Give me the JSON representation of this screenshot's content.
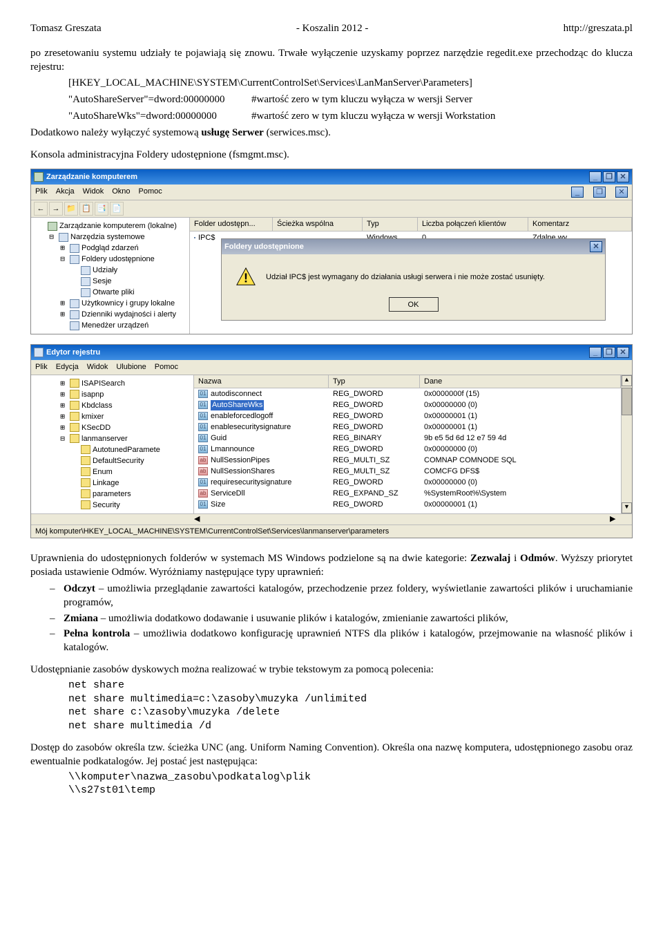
{
  "header": {
    "left": "Tomasz Greszata",
    "center": "- Koszalin 2012 -",
    "right": "http://greszata.pl"
  },
  "p1": "po zresetowaniu systemu udziały te pojawiają się znowu. Trwałe wyłączenie uzyskamy poprzez narzędzie regedit.exe przechodząc do klucza rejestru:",
  "reg_path": "[HKEY_LOCAL_MACHINE\\SYSTEM\\CurrentControlSet\\Services\\LanManServer\\Parameters]",
  "kv1k": "\"AutoShareServer\"=dword:00000000",
  "kv1v": "#wartość zero w tym kluczu wyłącza w wersji Server",
  "kv2k": "\"AutoShareWks\"=dword:00000000",
  "kv2v": "#wartość zero w tym kluczu wyłącza w wersji Workstation",
  "p2a": "Dodatkowo należy wyłączyć systemową ",
  "p2b": "usługę Serwer",
  "p2c": " (serwices.msc).",
  "p3": "Konsola administracyjna Foldery udostępnione (fsmgmt.msc).",
  "win1": {
    "title": "Zarządzanie komputerem",
    "menu": [
      "Plik",
      "Akcja",
      "Widok",
      "Okno",
      "Pomoc"
    ],
    "tree": [
      {
        "ind": 0,
        "exp": "",
        "ico": "g",
        "txt": "Zarządzanie komputerem (lokalne)"
      },
      {
        "ind": 1,
        "exp": "⊟",
        "ico": "b",
        "txt": "Narzędzia systemowe"
      },
      {
        "ind": 2,
        "exp": "⊞",
        "ico": "b",
        "txt": "Podgląd zdarzeń"
      },
      {
        "ind": 2,
        "exp": "⊟",
        "ico": "b",
        "txt": "Foldery udostępnione"
      },
      {
        "ind": 3,
        "exp": "",
        "ico": "b",
        "txt": "Udziały"
      },
      {
        "ind": 3,
        "exp": "",
        "ico": "b",
        "txt": "Sesje"
      },
      {
        "ind": 3,
        "exp": "",
        "ico": "b",
        "txt": "Otwarte pliki"
      },
      {
        "ind": 2,
        "exp": "⊞",
        "ico": "b",
        "txt": "Użytkownicy i grupy lokalne"
      },
      {
        "ind": 2,
        "exp": "⊞",
        "ico": "b",
        "txt": "Dzienniki wydajności i alerty"
      },
      {
        "ind": 2,
        "exp": "",
        "ico": "b",
        "txt": "Menedżer urządzeń"
      }
    ],
    "cols": [
      "Folder udostępn...",
      "Ścieżka wspólna",
      "Typ",
      "Liczba połączeń klientów",
      "Komentarz"
    ],
    "row": [
      "IPC$",
      "",
      "Windows",
      "0",
      "Zdalne wy"
    ],
    "dlg_title": "Foldery udostępnione",
    "dlg_msg": "Udział IPC$ jest wymagany do działania usługi serwera i nie może zostać usunięty.",
    "dlg_ok": "OK"
  },
  "win2": {
    "title": "Edytor rejestru",
    "menu": [
      "Plik",
      "Edycja",
      "Widok",
      "Ulubione",
      "Pomoc"
    ],
    "tree": [
      {
        "ind": 2,
        "exp": "⊞",
        "ico": "f",
        "txt": "ISAPISearch"
      },
      {
        "ind": 2,
        "exp": "⊞",
        "ico": "f",
        "txt": "isapnp"
      },
      {
        "ind": 2,
        "exp": "⊞",
        "ico": "f",
        "txt": "Kbdclass"
      },
      {
        "ind": 2,
        "exp": "⊞",
        "ico": "f",
        "txt": "kmixer"
      },
      {
        "ind": 2,
        "exp": "⊞",
        "ico": "f",
        "txt": "KSecDD"
      },
      {
        "ind": 2,
        "exp": "⊟",
        "ico": "f",
        "txt": "lanmanserver"
      },
      {
        "ind": 3,
        "exp": "",
        "ico": "f",
        "txt": "AutotunedParamete"
      },
      {
        "ind": 3,
        "exp": "",
        "ico": "f",
        "txt": "DefaultSecurity"
      },
      {
        "ind": 3,
        "exp": "",
        "ico": "f",
        "txt": "Enum"
      },
      {
        "ind": 3,
        "exp": "",
        "ico": "f",
        "txt": "Linkage"
      },
      {
        "ind": 3,
        "exp": "",
        "ico": "f",
        "txt": "parameters"
      },
      {
        "ind": 3,
        "exp": "",
        "ico": "f",
        "txt": "Security"
      }
    ],
    "cols": [
      "Nazwa",
      "Typ",
      "Dane"
    ],
    "rows": [
      {
        "ic": "bin",
        "n": "autodisconnect",
        "t": "REG_DWORD",
        "d": "0x0000000f (15)"
      },
      {
        "ic": "bin",
        "n": "AutoShareWks",
        "t": "REG_DWORD",
        "d": "0x00000000 (0)",
        "sel": true
      },
      {
        "ic": "bin",
        "n": "enableforcedlogoff",
        "t": "REG_DWORD",
        "d": "0x00000001 (1)"
      },
      {
        "ic": "bin",
        "n": "enablesecuritysignature",
        "t": "REG_DWORD",
        "d": "0x00000001 (1)"
      },
      {
        "ic": "bin",
        "n": "Guid",
        "t": "REG_BINARY",
        "d": "9b e5 5d 6d 12 e7 59 4d"
      },
      {
        "ic": "bin",
        "n": "Lmannounce",
        "t": "REG_DWORD",
        "d": "0x00000000 (0)"
      },
      {
        "ic": "str",
        "n": "NullSessionPipes",
        "t": "REG_MULTI_SZ",
        "d": "COMNAP COMNODE SQL"
      },
      {
        "ic": "str",
        "n": "NullSessionShares",
        "t": "REG_MULTI_SZ",
        "d": "COMCFG DFS$"
      },
      {
        "ic": "bin",
        "n": "requiresecuritysignature",
        "t": "REG_DWORD",
        "d": "0x00000000 (0)"
      },
      {
        "ic": "str",
        "n": "ServiceDll",
        "t": "REG_EXPAND_SZ",
        "d": "%SystemRoot%\\System"
      },
      {
        "ic": "bin",
        "n": "Size",
        "t": "REG_DWORD",
        "d": "0x00000001 (1)"
      }
    ],
    "status": "Mój komputer\\HKEY_LOCAL_MACHINE\\SYSTEM\\CurrentControlSet\\Services\\lanmanserver\\parameters"
  },
  "p4": "Uprawnienia do udostępnionych folderów w systemach MS Windows podzielone są na dwie kategorie: ",
  "p4b": "Zezwalaj",
  "p4c": " i ",
  "p4d": "Odmów",
  "p4e": ". Wyższy priorytet posiada ustawienie Odmów. Wyróżniamy następujące typy uprawnień:",
  "perms": [
    {
      "b": "Odczyt",
      "t": " – umożliwia przeglądanie zawartości katalogów, przechodzenie przez foldery, wyświetlanie zawartości plików i uruchamianie programów,"
    },
    {
      "b": "Zmiana",
      "t": "  – umożliwia dodatkowo dodawanie i usuwanie plików i  katalogów, zmienianie zawartości plików,"
    },
    {
      "b": "Pełna kontrola",
      "t": " – umożliwia dodatkowo konfigurację uprawnień NTFS dla plików i katalogów, przejmowanie na własność plików i katalogów."
    }
  ],
  "p5": "Udostępnianie zasobów dyskowych można realizować w trybie tekstowym za pomocą polecenia:",
  "cmds": [
    "net share",
    "net share multimedia=c:\\zasoby\\muzyka /unlimited",
    "net share c:\\zasoby\\muzyka /delete",
    "net share multimedia /d"
  ],
  "p6": "Dostęp do zasobów określa tzw. ścieżka UNC (ang. Uniform Naming Convention). Określa ona nazwę komputera, udostępnionego zasobu oraz ewentualnie podkatalogów. Jej postać jest następująca:",
  "unc": [
    "\\\\komputer\\nazwa_zasobu\\podkatalog\\plik",
    "\\\\s27st01\\temp"
  ]
}
